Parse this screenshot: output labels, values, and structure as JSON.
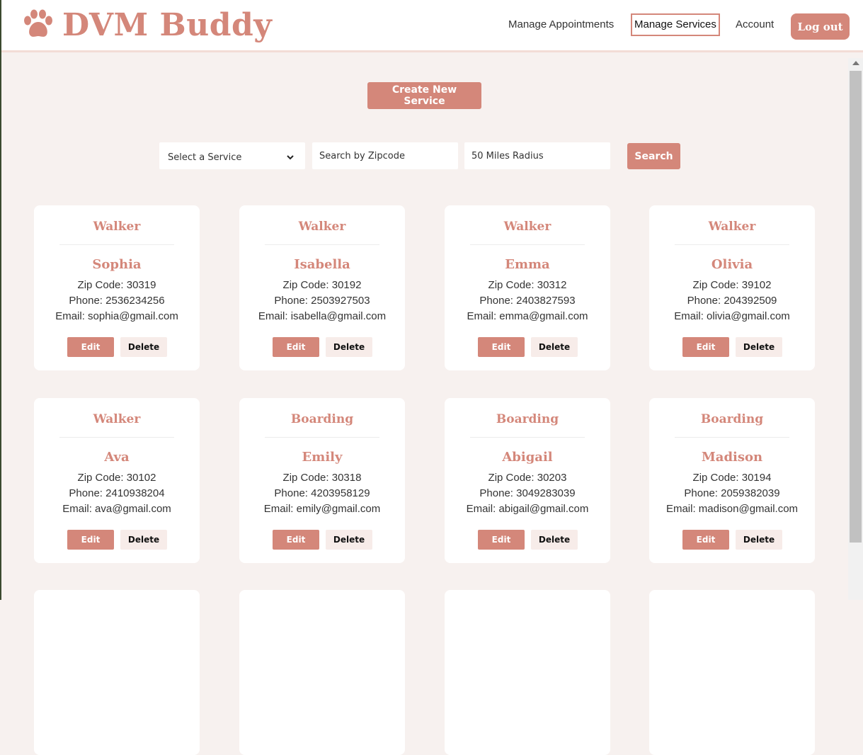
{
  "header": {
    "brand": "DVM Buddy",
    "logo_icon": "paw-icon",
    "nav": {
      "appointments": "Manage Appointments",
      "services": "Manage Services",
      "account": "Account",
      "logout": "Log out"
    }
  },
  "toolbar": {
    "create_label": "Create New Service",
    "service_select": "Select a Service",
    "zip_placeholder": "Search by Zipcode",
    "radius_value": "50 Miles Radius",
    "search_label": "Search"
  },
  "card_labels": {
    "zip": "Zip Code: ",
    "phone": "Phone: ",
    "email": "Email: ",
    "edit": "Edit",
    "delete": "Delete"
  },
  "services": [
    {
      "service": "Walker",
      "name": "Sophia",
      "zip": "30319",
      "phone": "2536234256",
      "email": "sophia@gmail.com"
    },
    {
      "service": "Walker",
      "name": "Isabella",
      "zip": "30192",
      "phone": "2503927503",
      "email": "isabella@gmail.com"
    },
    {
      "service": "Walker",
      "name": "Emma",
      "zip": "30312",
      "phone": "2403827593",
      "email": "emma@gmail.com"
    },
    {
      "service": "Walker",
      "name": "Olivia",
      "zip": "39102",
      "phone": "204392509",
      "email": "olivia@gmail.com"
    },
    {
      "service": "Walker",
      "name": "Ava",
      "zip": "30102",
      "phone": "2410938204",
      "email": "ava@gmail.com"
    },
    {
      "service": "Boarding",
      "name": "Emily",
      "zip": "30318",
      "phone": "4203958129",
      "email": "emily@gmail.com"
    },
    {
      "service": "Boarding",
      "name": "Abigail",
      "zip": "30203",
      "phone": "3049283039",
      "email": "abigail@gmail.com"
    },
    {
      "service": "Boarding",
      "name": "Madison",
      "zip": "30194",
      "phone": "2059382039",
      "email": "madison@gmail.com"
    }
  ],
  "colors": {
    "accent": "#d4877a",
    "background": "#f7f1ef"
  }
}
